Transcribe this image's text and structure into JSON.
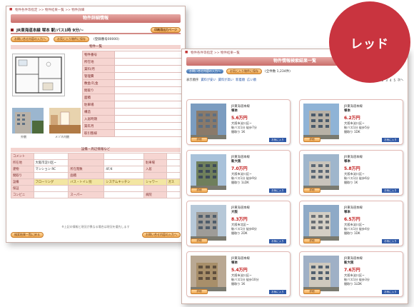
{
  "badge": {
    "label": "レッド",
    "color": "#c9343f"
  },
  "detail_window": {
    "breadcrumb": "物件各件等指定 >> 物件結果一覧 >> 物件詳細",
    "title": "物件詳細情報",
    "property_heading": "JR東海道本線 塚本 駅/バス1時 9分/~",
    "print_button": "印刷用出力ページ",
    "inquire_button": "お問い合せ内容の入力へ",
    "favorite_button": "お気に入り物件に保存",
    "reg_number": "(登録番号00000)",
    "section_photos": "物件一覧",
    "spec_rows": [
      {
        "label": "物件番号",
        "value": ""
      },
      {
        "label": "所在地",
        "value": ""
      },
      {
        "label": "賃料/月",
        "value": ""
      },
      {
        "label": "管理費",
        "value": ""
      },
      {
        "label": "敷金/礼金",
        "value": ""
      },
      {
        "label": "間取り",
        "value": ""
      },
      {
        "label": "面積",
        "value": ""
      },
      {
        "label": "駐車場",
        "value": ""
      },
      {
        "label": "構造",
        "value": ""
      },
      {
        "label": "入居時期",
        "value": ""
      },
      {
        "label": "築年月",
        "value": ""
      },
      {
        "label": "取引態様",
        "value": ""
      }
    ],
    "photo_captions": [
      "外観",
      "メゾネ内観"
    ],
    "equipment_heading": "設備・周辺情報など",
    "equipment_rows": [
      [
        "コメント",
        "",
        "",
        "",
        "",
        ""
      ],
      [
        "所在地",
        "大阪市淀川区~",
        "",
        "",
        "駐車場",
        ""
      ],
      [
        "建物",
        "マンション RC",
        "所在階数",
        "4F/4",
        "入居",
        ""
      ],
      [
        "間取り",
        "",
        "面積",
        "",
        "",
        ""
      ],
      [
        "設備",
        "フローリング",
        "バス・トイレ別",
        "システムキッチン",
        "シャワー",
        "ガス"
      ],
      [
        "保証",
        "",
        "",
        "",
        "",
        ""
      ],
      [
        "コンビニ",
        "",
        "スーパー",
        "",
        "病院",
        ""
      ]
    ],
    "back_button": "検索結果一覧に戻る",
    "inquire_bottom": "お問い合せ内容の入力へ",
    "note": "※上記の情報と現況が異なる場合は現況を優先します"
  },
  "list_window": {
    "breadcrumb": "物件各件等指定 >> 物件結果一覧",
    "title": "物件情報検索結果一覧",
    "top_buttons": [
      "お問い合せ内容の入力へ",
      "お気に入り物件に保存"
    ],
    "notice": "(全件数 1,234件)",
    "sort_label": "表示順序",
    "sort_options": [
      "賃料が安い",
      "賃料が高い",
      "新着順",
      "広い順"
    ],
    "pagination": [
      "前へ",
      "1",
      "2",
      "3",
      "4",
      "5",
      "次へ"
    ],
    "listings": [
      {
        "line": "JR東海道本線",
        "station": "塚本",
        "price": "5.6万円",
        "l1": "大阪市淀川区~",
        "l2": "駅バス1分 徒歩7分",
        "l3": "間取り 1K"
      },
      {
        "line": "JR東海道本線",
        "station": "塚本",
        "price": "6.2万円",
        "l1": "大阪市淀川区~",
        "l2": "駅バス1分 徒歩5分",
        "l3": "間取り 1DK"
      },
      {
        "line": "JR東海道本線",
        "station": "新大阪",
        "price": "7.0万円",
        "l1": "大阪市淀川区~",
        "l2": "駅バス1分 徒歩9分",
        "l3": "間取り 1LDK"
      },
      {
        "line": "JR東海道本線",
        "station": "塚本",
        "price": "5.8万円",
        "l1": "大阪市淀川区~",
        "l2": "駅バス1分 徒歩6分",
        "l3": "間取り 1K"
      },
      {
        "line": "JR東海道本線",
        "station": "大阪",
        "price": "8.3万円",
        "l1": "大阪市北区~",
        "l2": "駅バス1分 徒歩8分",
        "l3": "間取り 2DK"
      },
      {
        "line": "JR東海道本線",
        "station": "塚本",
        "price": "6.5万円",
        "l1": "大阪市淀川区~",
        "l2": "駅バス1分 徒歩4分",
        "l3": "間取り 1DK"
      },
      {
        "line": "JR東海道本線",
        "station": "塚本",
        "price": "5.4万円",
        "l1": "大阪市淀川区~",
        "l2": "駅バス1分 徒歩10分",
        "l3": "間取り 1K"
      },
      {
        "line": "JR東海道本線",
        "station": "新大阪",
        "price": "7.6万円",
        "l1": "大阪市淀川区~",
        "l2": "駅バス1分 徒歩3分",
        "l3": "間取り 1LDK"
      }
    ],
    "detail_label": "詳細",
    "fav_label": "お気に入り"
  }
}
